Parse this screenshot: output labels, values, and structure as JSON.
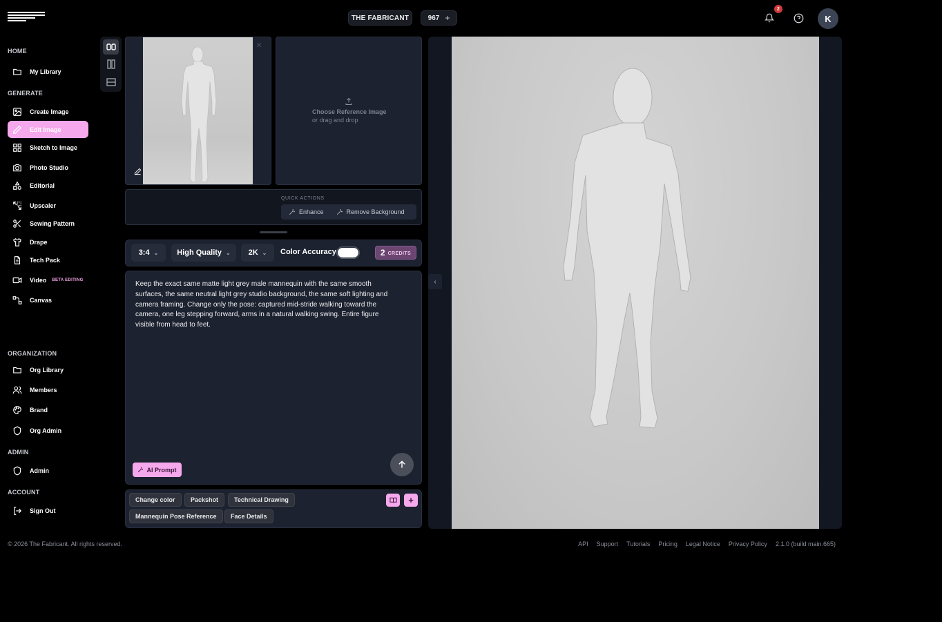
{
  "header": {
    "org_name": "THE FABRICANT",
    "credits_count": "967",
    "credits_plus": "+",
    "notification_count": "2",
    "avatar_initial": "K"
  },
  "sidebar": {
    "sections": {
      "home": "HOME",
      "generate": "GENERATE",
      "organization": "ORGANIZATION",
      "admin": "ADMIN",
      "account": "ACCOUNT"
    },
    "items": {
      "my_library": "My Library",
      "create_image": "Create Image",
      "edit_image": "Edit Image",
      "sketch_to_image": "Sketch to Image",
      "photo_studio": "Photo Studio",
      "editorial": "Editorial",
      "upscaler": "Upscaler",
      "sewing_pattern": "Sewing Pattern",
      "drape": "Drape",
      "tech_pack": "Tech Pack",
      "video": "Video",
      "video_badge": "BETA EDITING",
      "canvas": "Canvas",
      "org_library": "Org Library",
      "members": "Members",
      "brand": "Brand",
      "org_admin": "Org Admin",
      "admin": "Admin",
      "sign_out": "Sign Out"
    }
  },
  "editor": {
    "reference_title": "Choose Reference Image",
    "reference_sub": "or drag and drop",
    "quick_actions_label": "QUICK ACTIONS",
    "enhance_label": "Enhance",
    "remove_bg_label": "Remove Background",
    "aspect_ratio": "3:4",
    "quality": "High Quality",
    "resolution": "2K",
    "color_accuracy_label": "Color Accuracy",
    "color_accuracy_on": true,
    "credits_cost": "2",
    "credits_word": "CREDITS",
    "prompt": "Keep the exact same matte light grey male mannequin with the same smooth surfaces, the same neutral light grey studio background, the same soft lighting and camera framing. Change only the pose: captured mid-stride walking toward the camera, one leg stepping forward, arms in a natural walking swing. Entire figure visible from head to feet.",
    "ai_prompt_label": "AI Prompt",
    "chips": [
      "Change color",
      "Packshot",
      "Technical Drawing",
      "Mannequin Pose Reference",
      "Face Details"
    ]
  },
  "footer": {
    "copyright": "© 2026 The Fabricant. All rights reserved.",
    "links": [
      "API",
      "Support",
      "Tutorials",
      "Pricing",
      "Legal Notice",
      "Privacy Policy"
    ],
    "version": "2.1.0 (build main.665)"
  },
  "colors": {
    "accent_pink": "#f6a8ec",
    "panel_bg": "#1d2230",
    "background": "#000000"
  }
}
